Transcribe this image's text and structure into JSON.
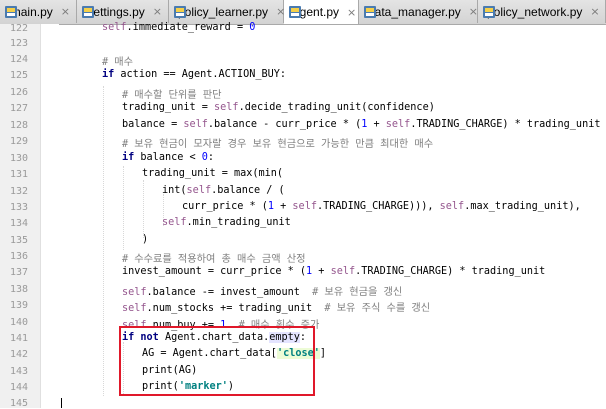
{
  "tabs": [
    {
      "label": "main.py",
      "close": "×",
      "active": false
    },
    {
      "label": "settings.py",
      "close": "×",
      "active": false
    },
    {
      "label": "policy_learner.py",
      "close": "×",
      "active": false
    },
    {
      "label": "agent.py",
      "close": "×",
      "active": true
    },
    {
      "label": "data_manager.py",
      "close": "×",
      "active": false
    },
    {
      "label": "policy_network.py",
      "close": "×",
      "active": false
    }
  ],
  "editor": {
    "file": "agent.py",
    "line_numbers": [
      "122",
      "123",
      "124",
      "125",
      "126",
      "127",
      "128",
      "129",
      "130",
      "131",
      "132",
      "133",
      "134",
      "135",
      "136",
      "137",
      "138",
      "139",
      "140",
      "141",
      "142",
      "143",
      "144",
      "145"
    ]
  },
  "code": {
    "l122": "self.immediate_reward = 0",
    "l124": "# 매수",
    "l125": "if action == Agent.ACTION_BUY:",
    "l126": "# 매수할 단위를 판단",
    "l127": "trading_unit = self.decide_trading_unit(confidence)",
    "l128": "balance = self.balance - curr_price * (1 + self.TRADING_CHARGE) * trading_unit",
    "l129": "# 보유 현금이 모자랄 경우 보유 현금으로 가능한 만큼 최대한 매수",
    "l130": "if balance < 0:",
    "l131": "trading_unit = max(min(",
    "l132": "int(self.balance / (",
    "l133": "curr_price * (1 + self.TRADING_CHARGE))), self.max_trading_unit),",
    "l134": "self.min_trading_unit",
    "l135": ")",
    "l136": "# 수수료를 적용하여 총 매수 금액 산정",
    "l137": "invest_amount = curr_price * (1 + self.TRADING_CHARGE) * trading_unit",
    "l138": "self.balance -= invest_amount  # 보유 현금을 갱신",
    "l139": "self.num_stocks += trading_unit  # 보유 주식 수를 갱신",
    "l140": "self.num_buy += 1  # 매수 횟수 증가",
    "l141": "if not Agent.chart_data.empty:",
    "l142": "AG = Agent.chart_data['close']",
    "l143": "print(AG)",
    "l144": "print('marker')"
  },
  "colors": {
    "keyword": "#000080",
    "self": "#94558d",
    "comment": "#808080",
    "string": "#008080",
    "number": "#0000ff",
    "highlight_box": "#e0182a"
  }
}
